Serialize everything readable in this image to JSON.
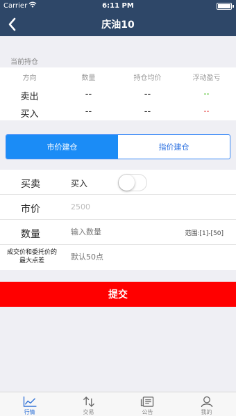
{
  "status_bar": {
    "carrier": "Carrier",
    "time": "6:11 PM"
  },
  "nav": {
    "title": "庆油10"
  },
  "position": {
    "section_label": "当前持仓",
    "headers": [
      "方向",
      "数量",
      "持仓均价",
      "浮动盈亏"
    ],
    "rows": [
      {
        "direction": "卖出",
        "quantity": "--",
        "avg_price": "--",
        "pnl": "--"
      },
      {
        "direction": "买入",
        "quantity": "--",
        "avg_price": "--",
        "pnl": "--"
      }
    ]
  },
  "order_tabs": [
    {
      "label": "市价建仓",
      "active": true
    },
    {
      "label": "指价建仓",
      "active": false
    }
  ],
  "form": {
    "side_label": "买卖",
    "side_value": "买入",
    "side_toggle_on": false,
    "price_label": "市价",
    "price_value": "2500",
    "qty_label": "数量",
    "qty_placeholder": "输入数量",
    "qty_range": "范围:[1]-[50]",
    "diff_label_line1": "成交价和委托价的",
    "diff_label_line2": "最大点差",
    "diff_placeholder": "默认50点"
  },
  "submit_label": "提交",
  "colors": {
    "nav": "#2e4768",
    "accent": "#1b8cf6",
    "submit": "#ff0000",
    "pnl_sell": "#2db400",
    "pnl_buy": "#e02020"
  },
  "tabbar": [
    {
      "icon": "line-chart-icon",
      "label": "行情",
      "active": true
    },
    {
      "icon": "transfer-arrows-icon",
      "label": "交易",
      "active": false
    },
    {
      "icon": "news-icon",
      "label": "公告",
      "active": false
    },
    {
      "icon": "user-icon",
      "label": "我的",
      "active": false
    }
  ]
}
